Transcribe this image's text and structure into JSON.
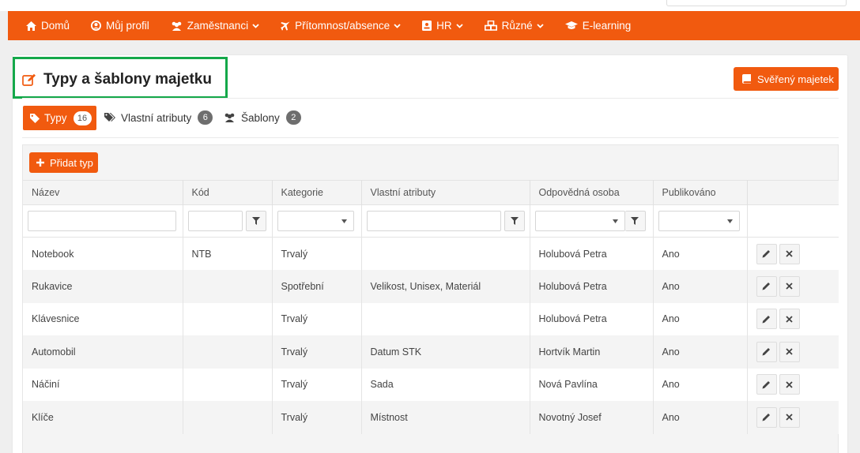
{
  "nav": {
    "items": [
      {
        "label": "Domů",
        "icon": "home-icon"
      },
      {
        "label": "Můj profil",
        "icon": "user-circle-icon"
      },
      {
        "label": "Zaměstnanci",
        "icon": "users-icon",
        "dropdown": true
      },
      {
        "label": "Přítomnost/absence",
        "icon": "plane-icon",
        "dropdown": true
      },
      {
        "label": "HR",
        "icon": "id-card-icon",
        "dropdown": true
      },
      {
        "label": "Různé",
        "icon": "cubes-icon",
        "dropdown": true
      },
      {
        "label": "E-learning",
        "icon": "graduation-cap-icon"
      }
    ]
  },
  "page": {
    "title": "Typy a šablony majetku",
    "top_button": "Svěřený majetek"
  },
  "tabs": [
    {
      "label": "Typy",
      "count": "16",
      "active": true
    },
    {
      "label": "Vlastní atributy",
      "count": "6"
    },
    {
      "label": "Šablony",
      "count": "2"
    }
  ],
  "toolbar": {
    "add_label": "Přidat typ"
  },
  "table": {
    "columns": [
      "Název",
      "Kód",
      "Kategorie",
      "Vlastní atributy",
      "Odpovědná osoba",
      "Publikováno",
      ""
    ],
    "rows": [
      {
        "name": "Notebook",
        "code": "NTB",
        "category": "Trvalý",
        "attrs": "",
        "person": "Holubová Petra",
        "published": "Ano"
      },
      {
        "name": "Rukavice",
        "code": "",
        "category": "Spotřební",
        "attrs": "Velikost, Unisex, Materiál",
        "person": "Holubová Petra",
        "published": "Ano"
      },
      {
        "name": "Klávesnice",
        "code": "",
        "category": "Trvalý",
        "attrs": "",
        "person": "Holubová Petra",
        "published": "Ano"
      },
      {
        "name": "Automobil",
        "code": "",
        "category": "Trvalý",
        "attrs": "Datum STK",
        "person": "Hortvík Martin",
        "published": "Ano"
      },
      {
        "name": "Náčiní",
        "code": "",
        "category": "Trvalý",
        "attrs": "Sada",
        "person": "Nová Pavlína",
        "published": "Ano"
      },
      {
        "name": "Klíče",
        "code": "",
        "category": "Trvalý",
        "attrs": "Místnost",
        "person": "Novotný Josef",
        "published": "Ano"
      }
    ]
  },
  "colors": {
    "accent": "#f15a0f",
    "highlight_box": "#14a84a"
  }
}
